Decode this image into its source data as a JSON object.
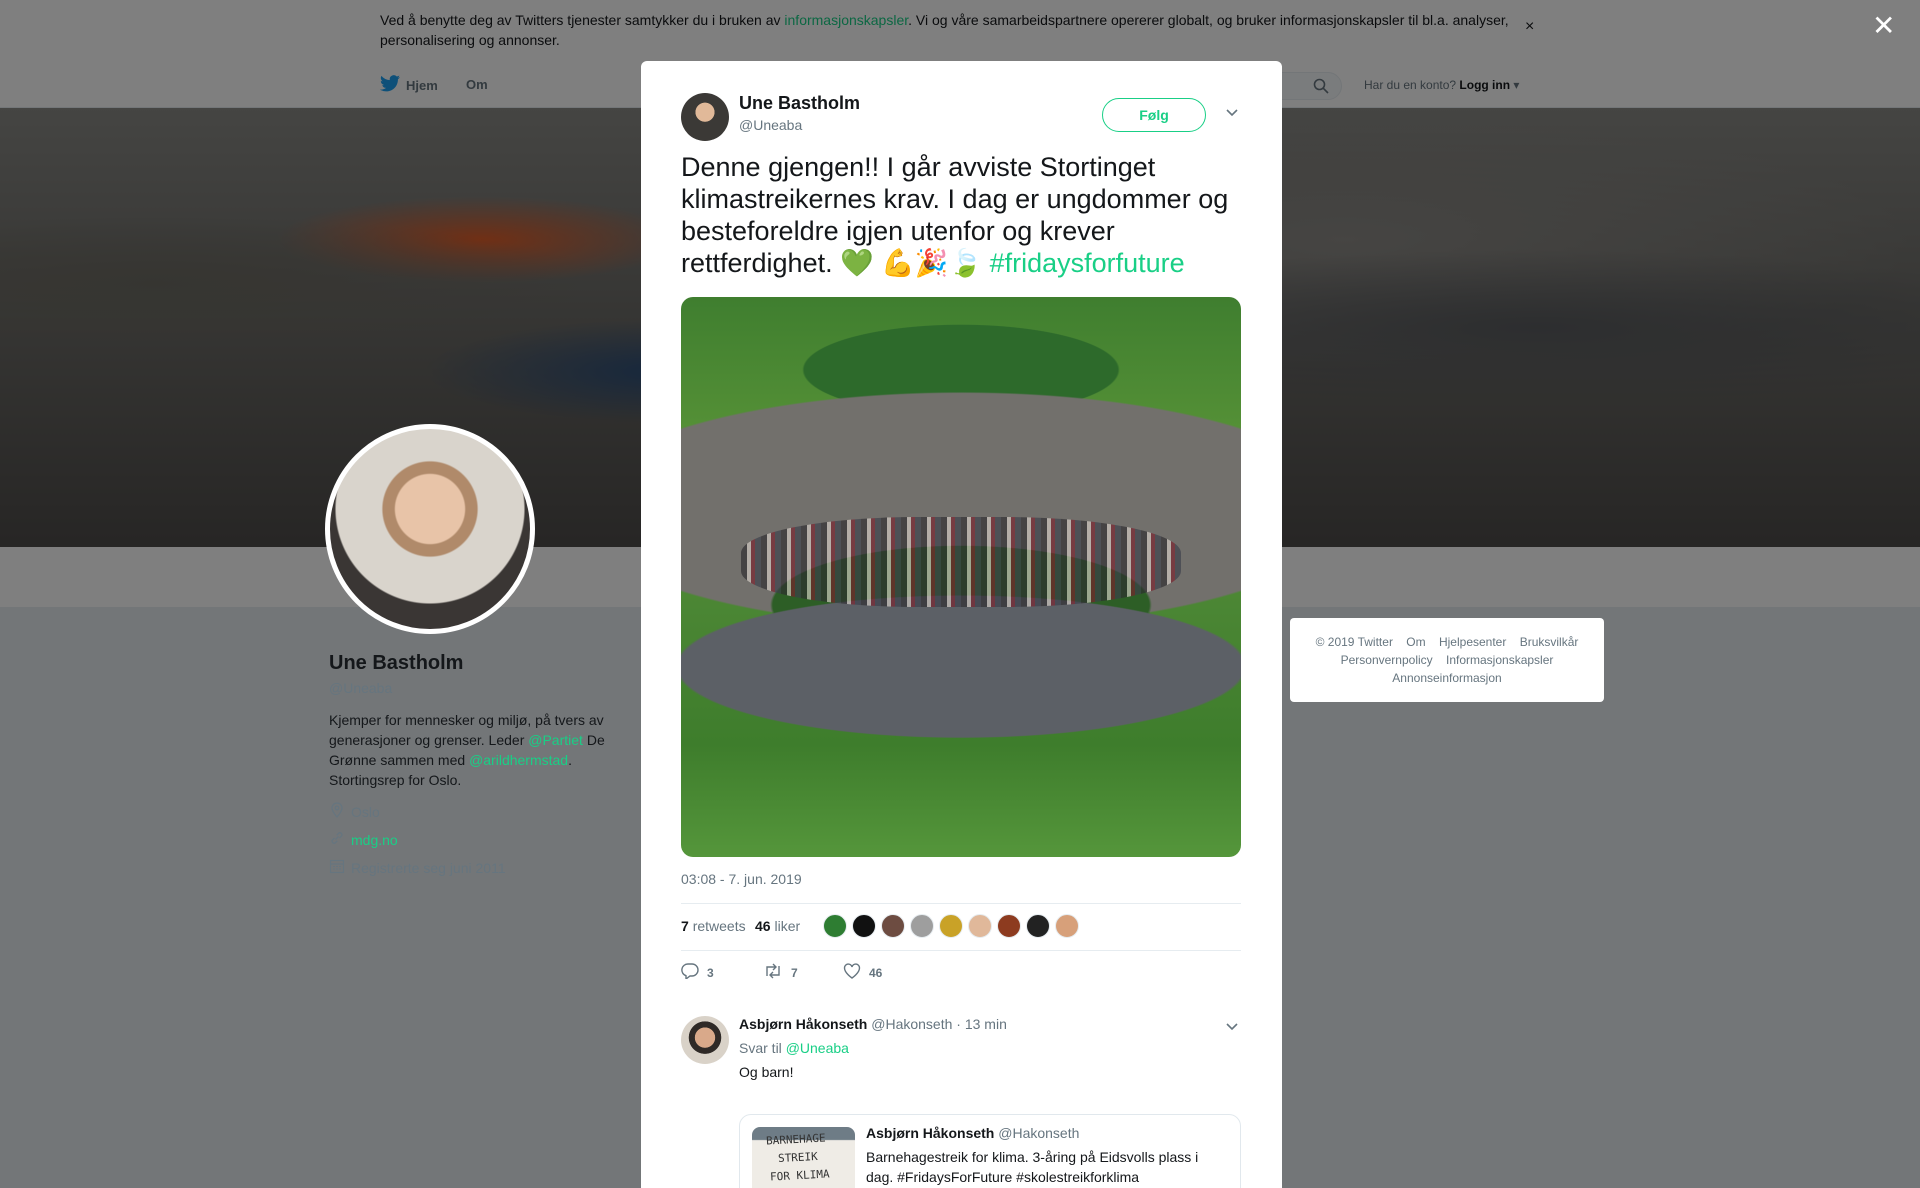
{
  "cookie": {
    "text_before": "Ved å benytte deg av Twitters tjenester samtykker du i bruken av ",
    "link": "informasjonskapsler",
    "text_after": ". Vi og våre samarbeidspartnere opererer globalt, og bruker informasjonskapsler til bl.a. analyser, personalisering og annonser.",
    "close": "×"
  },
  "nav": {
    "home": "Hjem",
    "about": "Om",
    "account_prompt": "Har du en konto?",
    "login": "Logg inn"
  },
  "profile": {
    "name": "Une Bastholm",
    "handle": "@Uneaba",
    "bio_1": "Kjemper for mennesker og miljø, på tvers av generasjoner og grenser. Leder ",
    "bio_link_1": "@Partiet",
    "bio_2": " De Grønne sammen med ",
    "bio_link_2": "@arildhermstad",
    "bio_3": ". Stortingsrep for Oslo.",
    "location": "Oslo",
    "website": "mdg.no",
    "joined": "Registrerte seg juni 2011"
  },
  "footer": {
    "links": [
      "© 2019 Twitter",
      "Om",
      "Hjelpesenter",
      "Bruksvilkår",
      "Personvernpolicy",
      "Informasjonskapsler",
      "Annonseinformasjon"
    ]
  },
  "tweet": {
    "author_name": "Une Bastholm",
    "author_handle": "@Uneaba",
    "follow": "Følg",
    "text": "Denne gjengen!! I går avviste Stortinget klimastreikernes krav. I dag er ungdommer og besteforeldre igjen utenfor og krever rettferdighet. 💚 💪🎉🍃 ",
    "hashtag": "#fridaysforfuture",
    "timestamp": "03:08 - 7. jun. 2019",
    "retweets_count": "7",
    "retweets_label": "retweets",
    "likes_count": "46",
    "likes_label": "liker",
    "likers_colors": [
      "#2e7d32",
      "#111111",
      "#6d4c41",
      "#9e9e9e",
      "#c9a227",
      "#e0b89a",
      "#8d3b1f",
      "#222222",
      "#d7a07a"
    ],
    "reply_count": "3",
    "retweet_action_count": "7",
    "like_action_count": "46"
  },
  "reply": {
    "name": "Asbjørn Håkonseth",
    "handle": "@Hakonseth",
    "time": "· 13 min",
    "reply_to_label": "Svar til",
    "reply_to_handle": "@Uneaba",
    "text": "Og barn!",
    "quote_name": "Asbjørn Håkonseth",
    "quote_handle": "@Hakonseth",
    "quote_text": "Barnehagestreik for klima. 3-åring på Eidsvolls plass i dag. #FridaysForFuture #skolestreikforklima",
    "quote_img_line1": "BARNEHAGE",
    "quote_img_line2": "STREIK",
    "quote_img_line3": "FOR KLIMA"
  },
  "colors": {
    "accent": "#19cf86",
    "twitter_blue": "#1da1f2",
    "text_secondary": "#66757f"
  }
}
